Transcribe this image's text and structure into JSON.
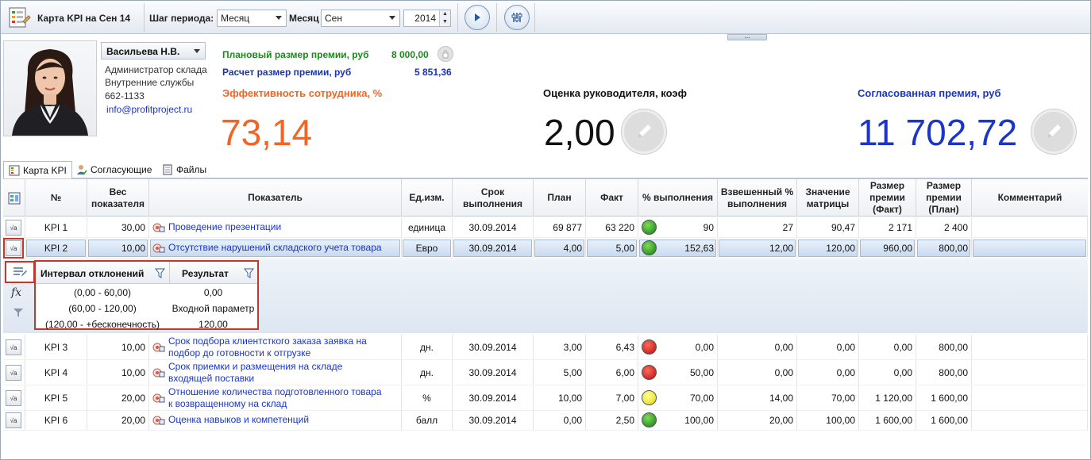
{
  "toolbar": {
    "title": "Карта KPI на Сен 14",
    "step_label": "Шаг периода:",
    "step_value": "Месяц",
    "month_label": "Месяц",
    "month_value": "Сен",
    "year_value": "2014",
    "expander": "..."
  },
  "employee": {
    "name": "Васильева Н.В.",
    "position": "Администратор склада",
    "department": "Внутренние службы",
    "phone": "662-1133",
    "email": "info@profitproject.ru"
  },
  "bonus": {
    "planned_label": "Плановый размер премии, руб",
    "planned_value": "8 000,00",
    "calc_label": "Расчет размер премии, руб",
    "calc_value": "5 851,36"
  },
  "metrics": {
    "efficiency_label": "Эффективность сотрудника, %",
    "efficiency_value": "73,14",
    "manager_label": "Оценка руководителя, коэф",
    "manager_value": "2,00",
    "agreed_label": "Согласованная премия, руб",
    "agreed_value": "11 702,72"
  },
  "colors": {
    "efficiency": "#f26522",
    "agreed": "#1a35c8",
    "planned": "#1a8a1a",
    "calc": "#1a35a8"
  },
  "tabs": [
    {
      "label": "Карта KPI",
      "icon": "kpi-card-icon"
    },
    {
      "label": "Согласующие",
      "icon": "user-check-icon"
    },
    {
      "label": "Файлы",
      "icon": "document-icon"
    }
  ],
  "grid": {
    "headers": {
      "num": "№",
      "weight": "Вес показателя",
      "indicator": "Показатель",
      "unit": "Ед.изм.",
      "due": "Срок выполнения",
      "plan": "План",
      "fact": "Факт",
      "pct": "% выполнения",
      "weighted": "Взвешенный % выполнения",
      "matrix": "Значение матрицы",
      "bonus_fact": "Размер премии (Факт)",
      "bonus_plan": "Размер премии (План)",
      "comment": "Комментарий"
    },
    "rows": [
      {
        "num": "KPI 1",
        "weight": "30,00",
        "indicator": "Проведение презентации",
        "indicator2": "",
        "unit": "единица",
        "due": "30.09.2014",
        "plan": "69 877",
        "fact": "63 220",
        "lamp": "green",
        "pct": "90",
        "weighted": "27",
        "matrix": "90,47",
        "bonus_fact": "2 171",
        "bonus_plan": "2 400",
        "comment": ""
      },
      {
        "num": "KPI 2",
        "weight": "10,00",
        "indicator": "Отсутствие нарушений складского учета товара",
        "indicator2": "",
        "unit": "Евро",
        "due": "30.09.2014",
        "plan": "4,00",
        "fact": "5,00",
        "lamp": "green",
        "pct": "152,63",
        "weighted": "12,00",
        "matrix": "120,00",
        "bonus_fact": "960,00",
        "bonus_plan": "800,00",
        "comment": ""
      },
      {
        "num": "KPI 3",
        "weight": "10,00",
        "indicator": "Срок подбора клиентсткого заказа заявка на",
        "indicator2": "подбор до готовности к отгрузке",
        "unit": "дн.",
        "due": "30.09.2014",
        "plan": "3,00",
        "fact": "6,43",
        "lamp": "red",
        "pct": "0,00",
        "weighted": "0,00",
        "matrix": "0,00",
        "bonus_fact": "0,00",
        "bonus_plan": "800,00",
        "comment": ""
      },
      {
        "num": "KPI 4",
        "weight": "10,00",
        "indicator": "Срок приемки и размещения на складе",
        "indicator2": "входящей поставки",
        "unit": "дн.",
        "due": "30.09.2014",
        "plan": "5,00",
        "fact": "6,00",
        "lamp": "red",
        "pct": "50,00",
        "weighted": "0,00",
        "matrix": "0,00",
        "bonus_fact": "0,00",
        "bonus_plan": "800,00",
        "comment": ""
      },
      {
        "num": "KPI 5",
        "weight": "20,00",
        "indicator": "Отношение количества подготовленного товара",
        "indicator2": "к возвращенному на склад",
        "unit": "%",
        "due": "30.09.2014",
        "plan": "10,00",
        "fact": "7,00",
        "lamp": "yellow",
        "pct": "70,00",
        "weighted": "14,00",
        "matrix": "70,00",
        "bonus_fact": "1 120,00",
        "bonus_plan": "1 600,00",
        "comment": ""
      },
      {
        "num": "KPI 6",
        "weight": "20,00",
        "indicator": "Оценка навыков и компетенций",
        "indicator2": "",
        "unit": "балл",
        "due": "30.09.2014",
        "plan": "0,00",
        "fact": "2,50",
        "lamp": "green",
        "pct": "100,00",
        "weighted": "20,00",
        "matrix": "100,00",
        "bonus_fact": "1 600,00",
        "bonus_plan": "1 600,00",
        "comment": ""
      }
    ]
  },
  "detail": {
    "col_interval": "Интервал отклонений",
    "col_result": "Результат",
    "rows": [
      {
        "interval": "(0,00 - 60,00)",
        "result": "0,00"
      },
      {
        "interval": "(60,00 - 120,00)",
        "result": "Входной параметр"
      },
      {
        "interval": "(120,00 - +бесконечность)",
        "result": "120,00"
      }
    ]
  }
}
